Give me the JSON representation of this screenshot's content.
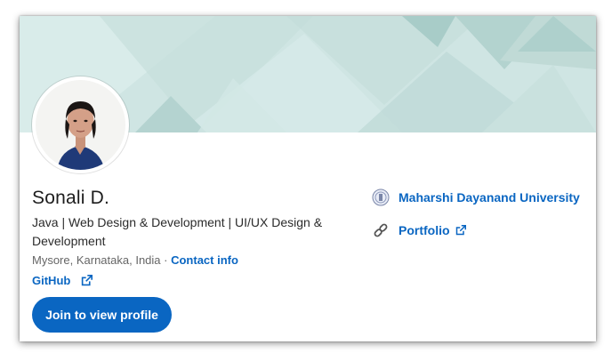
{
  "profile": {
    "name": "Sonali D.",
    "headline": "Java | Web Design & Development | UI/UX Design & Development",
    "location": "Mysore, Karnataka, India",
    "separator": " · ",
    "contact_label": "Contact info",
    "github_label": "GitHub",
    "join_button": "Join to view profile"
  },
  "sidebar": {
    "education": "Maharshi Dayanand University",
    "portfolio": "Portfolio"
  },
  "icons": {
    "university": "university-seal-icon",
    "link": "link-icon",
    "external": "external-link-icon"
  },
  "colors": {
    "accent": "#0a66c2",
    "banner": "#cfe4e2",
    "text": "#1d1d1d",
    "muted": "#666666"
  }
}
